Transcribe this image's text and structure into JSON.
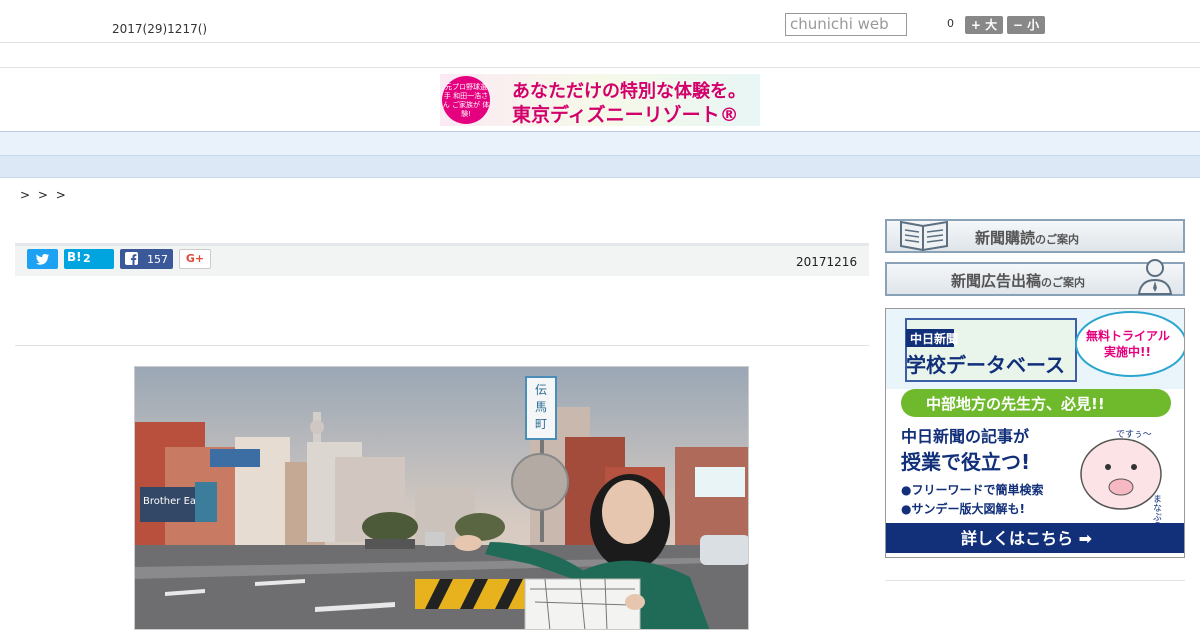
{
  "header": {
    "date": "2017(29)1217()",
    "search_placeholder": "chunichi web",
    "count": "0",
    "font_up_label": "+ 大",
    "font_down_label": "− 小"
  },
  "banner": {
    "badge_text": "元プロ野球選手 和田一浩さん ご家族が 体験!",
    "line1": "あなただけの特別な体験を。",
    "line2": "東京ディズニーリゾート®"
  },
  "nav": {
    "items": [
      "",
      "",
      "",
      "",
      "",
      "",
      "",
      "",
      ""
    ]
  },
  "breadcrumb": "> > >",
  "article": {
    "share": {
      "hatena_label": "B!",
      "hatena_count": "2",
      "facebook_count": "157",
      "gplus_label": "G+"
    },
    "date": "20171216",
    "photo": {
      "sign_text": "伝馬町",
      "building_sign": "Brother Earth"
    }
  },
  "sidebar": {
    "subscribe": {
      "big": "新聞購読",
      "small": "のご案内"
    },
    "advertise": {
      "big": "新聞広告出稿",
      "small": "のご案内"
    },
    "ad": {
      "brand": "中日新聞",
      "title": "学校データベース",
      "trial": "無料トライアル実施中!!",
      "subtitle": "中部地方の先生方、必見!!",
      "headline1": "中日新聞の記事が",
      "headline2": "授業で役立つ!",
      "bullet1": "●フリーワードで簡単検索",
      "bullet2": "●サンデー版大図解も!",
      "cta": "詳しくはこちら ➡",
      "mascot": "まなぶう",
      "mascot_speech": "ですぅ〜"
    }
  },
  "colors": {
    "twitter": "#1da1f2",
    "hatena": "#00a4de",
    "facebook": "#3b5998",
    "nav_bg": "#e9f1fa",
    "ad_green": "#6fba2c",
    "ad_navy": "#12307a"
  }
}
